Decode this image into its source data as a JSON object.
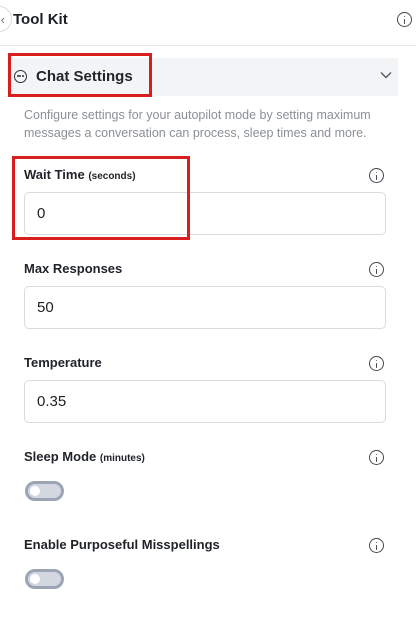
{
  "header": {
    "title": "Tool Kit",
    "back_icon": "chevron-left-icon",
    "info_icon": "info-icon"
  },
  "accordion": {
    "title": "Chat Settings",
    "icon": "chat-bubble-icon",
    "expand_icon": "chevron-down-icon",
    "expanded": true
  },
  "description": "Configure settings for your autopilot mode by setting maximum messages a conversation can process, sleep times and more.",
  "fields": {
    "wait_time": {
      "label": "Wait Time",
      "unit": "(seconds)",
      "value": "0"
    },
    "max_responses": {
      "label": "Max Responses",
      "value": "50"
    },
    "temperature": {
      "label": "Temperature",
      "value": "0.35"
    }
  },
  "toggles": {
    "sleep_mode": {
      "label": "Sleep Mode",
      "unit": "(minutes)",
      "enabled": false
    },
    "misspellings": {
      "label": "Enable Purposeful Misspellings",
      "enabled": false
    }
  },
  "colors": {
    "highlight": "#d91e1e",
    "toggle_off": "#d3d8e0",
    "accordion_bg": "#f3f4f6",
    "description": "#8a9097"
  }
}
